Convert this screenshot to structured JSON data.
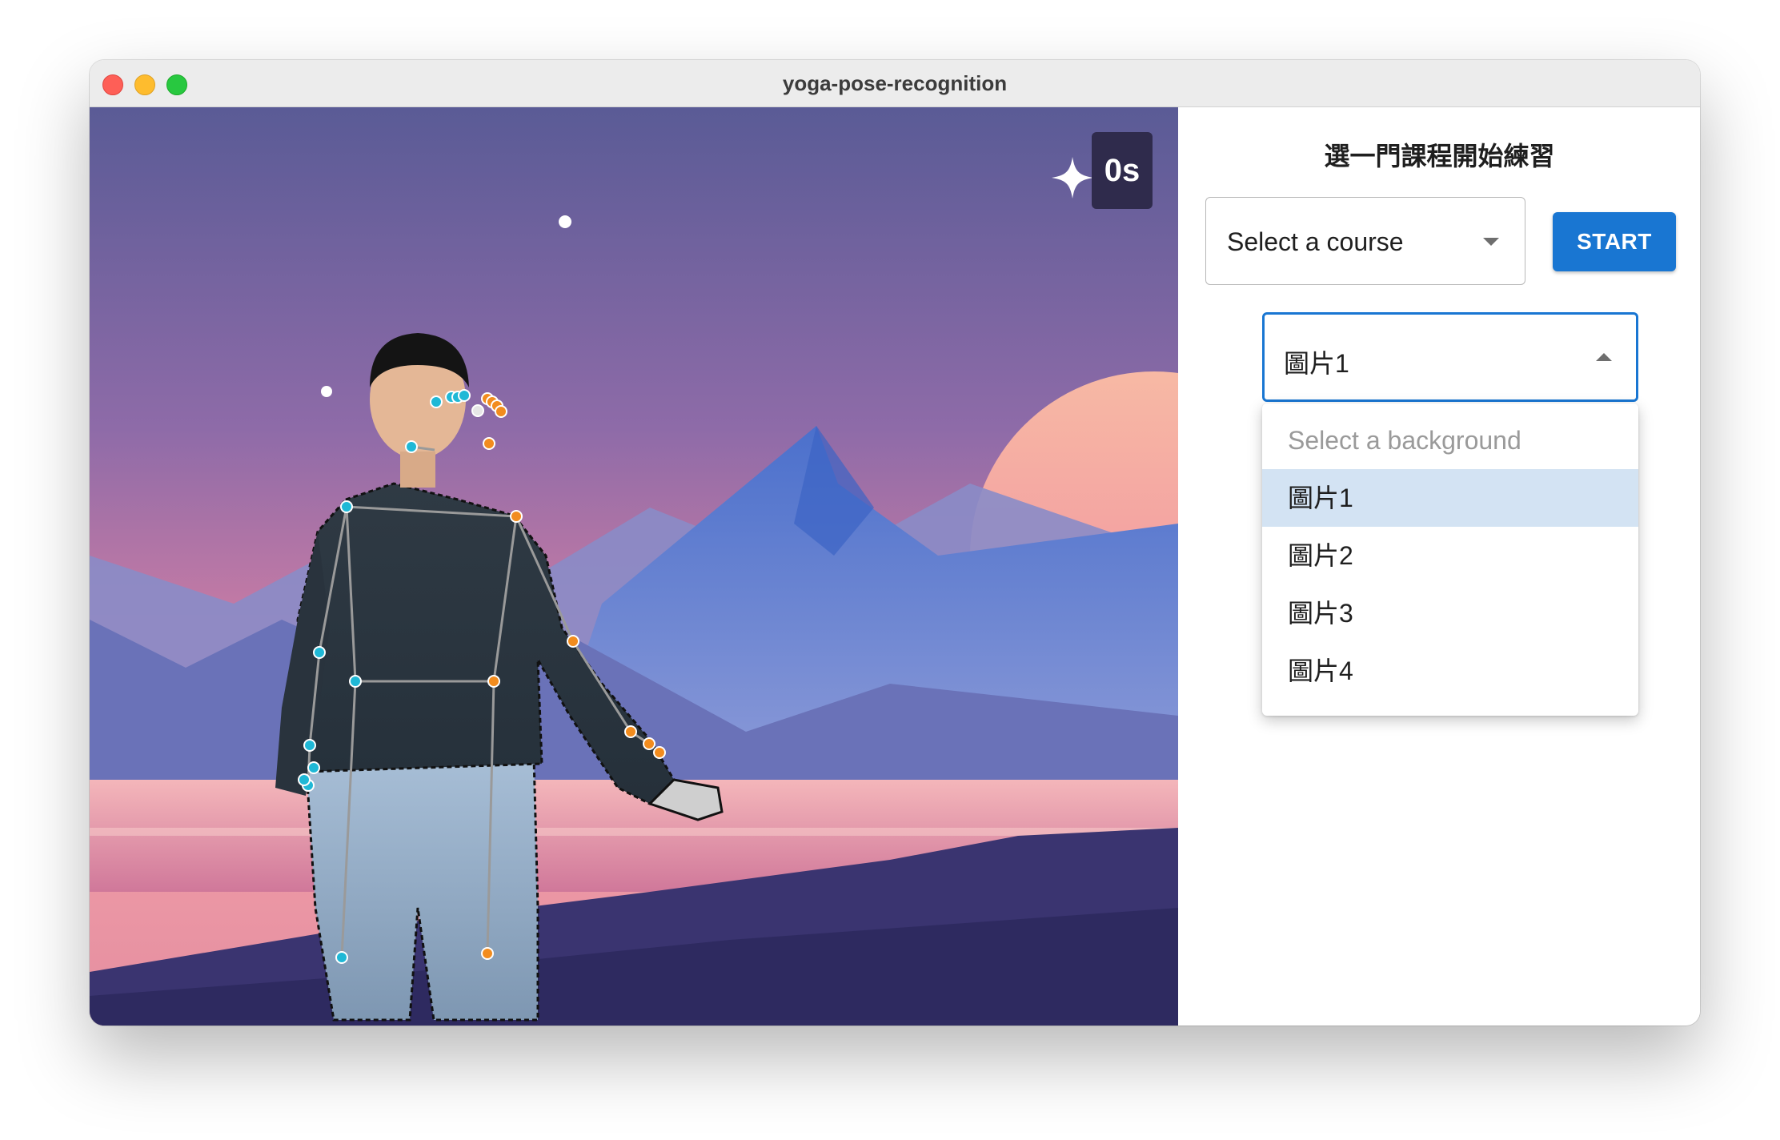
{
  "window": {
    "title": "yoga-pose-recognition"
  },
  "stage": {
    "timer": "0s"
  },
  "panel": {
    "heading": "選一門課程開始練習",
    "course_select": {
      "value": "Select a course"
    },
    "start_button": "START",
    "background_select": {
      "value": "圖片1",
      "placeholder": "Select a background",
      "options": [
        "圖片1",
        "圖片2",
        "圖片3",
        "圖片4"
      ],
      "selected_index": 0
    }
  },
  "colors": {
    "accent": "#1976d2",
    "selected_option_bg": "#d3e3f3",
    "left_keypoint": "#1fb8d6",
    "right_keypoint": "#f28c1e"
  },
  "icons": [
    "sparkle-icon",
    "dropdown-arrow-icon"
  ]
}
